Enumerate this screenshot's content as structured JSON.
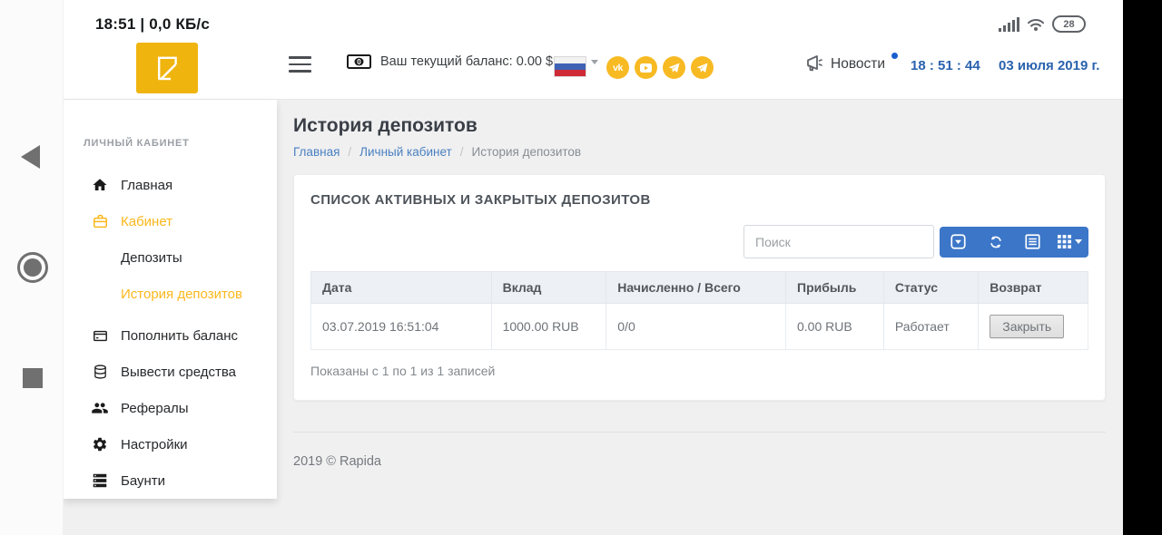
{
  "status_bar": {
    "left_text": "18:51 | 0,0 КБ/с",
    "battery_percent": "28"
  },
  "header": {
    "balance_text": "Ваш текущий баланс: 0.00 $",
    "news_label": "Новости",
    "time": "18 : 51 : 44",
    "date": "03 июля 2019 г."
  },
  "icons": {
    "vk_text": "vk"
  },
  "sidebar": {
    "section_label": "ЛИЧНЫЙ КАБИНЕТ",
    "items": [
      {
        "label": "Главная",
        "icon": "home-icon",
        "active": false
      },
      {
        "label": "Кабинет",
        "icon": "briefcase-icon",
        "active": true
      },
      {
        "label": "Депозиты",
        "icon": null,
        "active": false
      },
      {
        "label": "История депозитов",
        "icon": null,
        "active": true
      },
      {
        "label": "Пополнить баланс",
        "icon": "credit-card-icon",
        "active": false
      },
      {
        "label": "Вывести средства",
        "icon": "database-icon",
        "active": false
      },
      {
        "label": "Рефералы",
        "icon": "users-icon",
        "active": false
      },
      {
        "label": "Настройки",
        "icon": "gear-icon",
        "active": false
      },
      {
        "label": "Баунти",
        "icon": "server-icon",
        "active": false
      }
    ]
  },
  "page": {
    "title": "История депозитов"
  },
  "breadcrumb": {
    "items": [
      "Главная",
      "Личный кабинет",
      "История депозитов"
    ],
    "separator": "/"
  },
  "card": {
    "title": "СПИСОК АКТИВНЫХ И ЗАКРЫТЫХ ДЕПОЗИТОВ",
    "search_placeholder": "Поиск",
    "table": {
      "headers": [
        "Дата",
        "Вклад",
        "Начисленно / Всего",
        "Прибыль",
        "Статус",
        "Возврат"
      ],
      "row": {
        "date": "03.07.2019 16:51:04",
        "amount": "1000.00 RUB",
        "accrued": "0/0",
        "profit": "0.00 RUB",
        "status": "Работает",
        "action_label": "Закрыть"
      }
    },
    "summary": "Показаны с 1 по 1 из 1 записей"
  },
  "footer": {
    "copyright": "2019 © Rapida"
  },
  "colors": {
    "logo_yellow": "#f0b40f",
    "accent_yellow": "#fbb81c",
    "social_yellow": "#f7ba23",
    "toolbar_blue": "#3c76c8",
    "link_blue": "#4a80bf",
    "time_blue": "#2a62ae",
    "content_bg": "#f0f0f1"
  }
}
